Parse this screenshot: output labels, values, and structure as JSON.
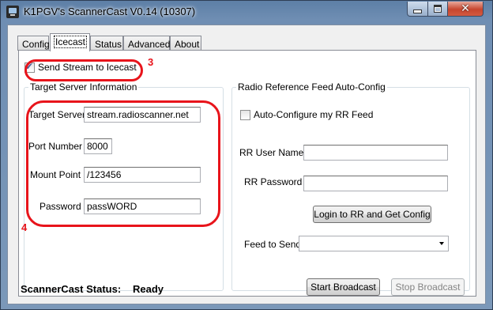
{
  "window": {
    "title": "K1PGV's ScannerCast V0.14 (10307)",
    "controls": {
      "minimize_icon": "minimize-icon",
      "maximize_icon": "maximize-icon",
      "close_icon": "close-icon",
      "close_glyph": "✕"
    }
  },
  "tabs": [
    {
      "label": "Config",
      "active": false
    },
    {
      "label": "Icecast",
      "active": true
    },
    {
      "label": "Status",
      "active": false
    },
    {
      "label": "Advanced",
      "active": false
    },
    {
      "label": "About",
      "active": false
    }
  ],
  "icecast": {
    "send_stream_label": "Send Stream to Icecast",
    "send_stream_checked": true,
    "target_group": {
      "title": "Target Server Information",
      "server_label": "Target Server",
      "server_value": "stream.radioscanner.net",
      "port_label": "Port Number",
      "port_value": "8000",
      "mount_label": "Mount Point",
      "mount_value": "/123456",
      "password_label": "Password",
      "password_value": "passWORD"
    },
    "rr_group": {
      "title": "Radio Reference Feed Auto-Config",
      "auto_config_label": "Auto-Configure my RR Feed",
      "auto_config_checked": false,
      "user_label": "RR User Name",
      "user_value": "",
      "password_label": "RR Password",
      "password_value": "",
      "login_button": "Login to RR and Get Config",
      "feed_label": "Feed to Send",
      "feed_value": ""
    }
  },
  "status_bar": {
    "label": "ScannerCast Status:",
    "value": "Ready",
    "start_button": "Start Broadcast",
    "stop_button": "Stop Broadcast",
    "stop_enabled": false
  },
  "annotations": {
    "marker_3": "3",
    "marker_4": "4",
    "color": "#e8141b"
  },
  "colors": {
    "title_bar": "#6f8eb3",
    "close_button": "#c7462f",
    "annotation": "#e8141b"
  }
}
